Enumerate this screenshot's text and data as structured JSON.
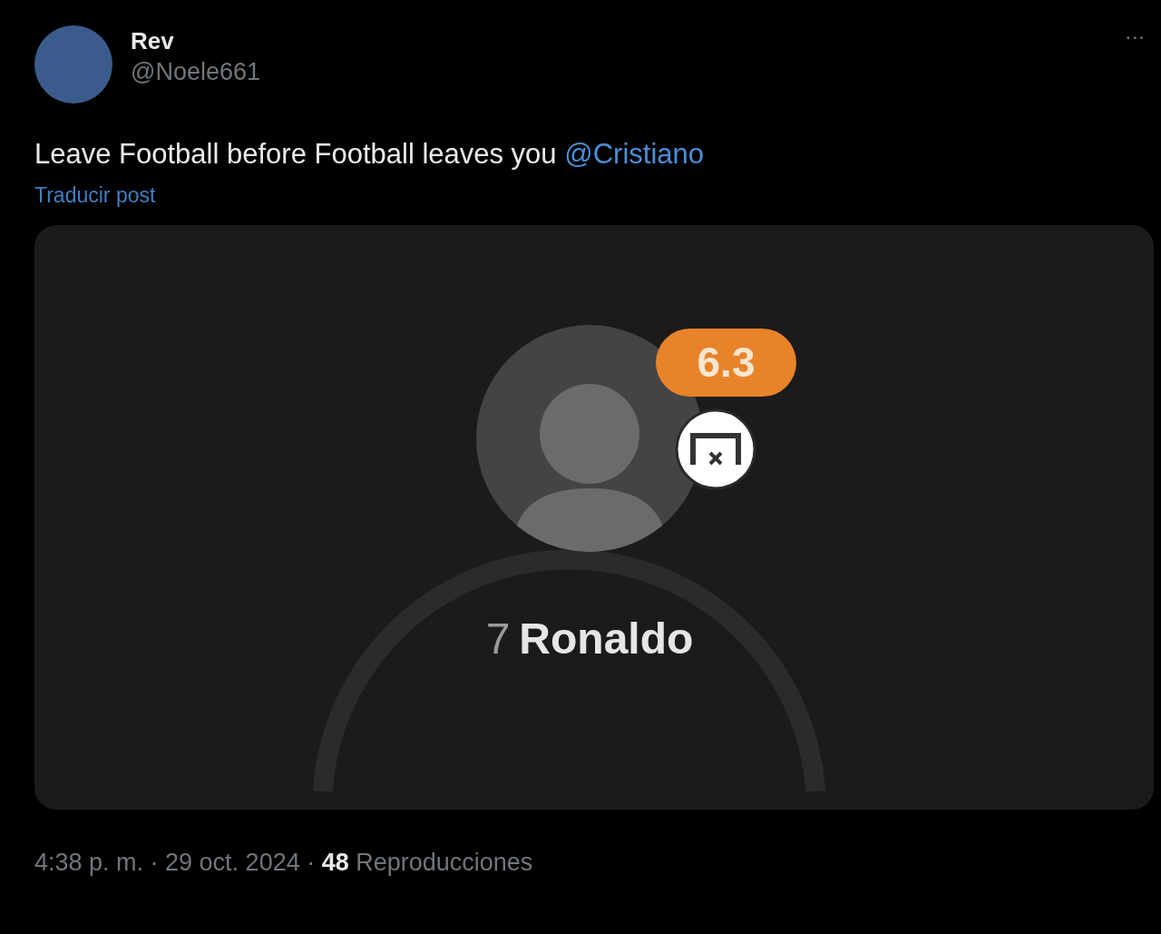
{
  "author": {
    "name": "Rev",
    "handle": "@Noele661"
  },
  "post": {
    "text": "Leave Football before Football leaves you",
    "mention": "@Cristiano",
    "translate_link": "Traducir post"
  },
  "more_button": "···",
  "media": {
    "rating": "6.3",
    "shirt_number": "7",
    "player_name": "Ronaldo"
  },
  "footer": "4:38 p. m. · 29 oct. 2024 · **48** Reproducciones"
}
